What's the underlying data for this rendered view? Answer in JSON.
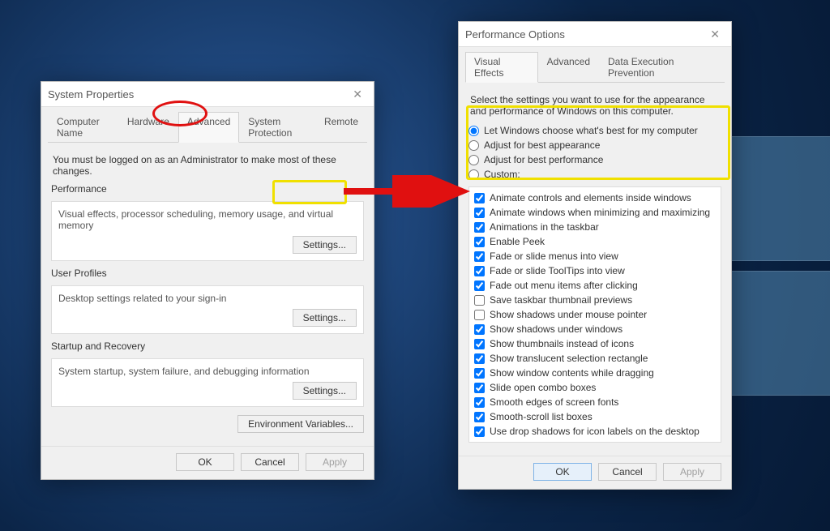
{
  "sys": {
    "title": "System Properties",
    "tabs": [
      "Computer Name",
      "Hardware",
      "Advanced",
      "System Protection",
      "Remote"
    ],
    "active_tab": 2,
    "admin_note": "You must be logged on as an Administrator to make most of these changes.",
    "perf": {
      "title": "Performance",
      "desc": "Visual effects, processor scheduling, memory usage, and virtual memory",
      "btn": "Settings..."
    },
    "profiles": {
      "title": "User Profiles",
      "desc": "Desktop settings related to your sign-in",
      "btn": "Settings..."
    },
    "startup": {
      "title": "Startup and Recovery",
      "desc": "System startup, system failure, and debugging information",
      "btn": "Settings..."
    },
    "envvar_btn": "Environment Variables...",
    "ok": "OK",
    "cancel": "Cancel",
    "apply": "Apply"
  },
  "perf": {
    "title": "Performance Options",
    "tabs": [
      "Visual Effects",
      "Advanced",
      "Data Execution Prevention"
    ],
    "active_tab": 0,
    "intro": "Select the settings you want to use for the appearance and performance of Windows on this computer.",
    "radios": [
      {
        "label": "Let Windows choose what's best for my computer",
        "checked": true
      },
      {
        "label": "Adjust for best appearance",
        "checked": false
      },
      {
        "label": "Adjust for best performance",
        "checked": false
      },
      {
        "label": "Custom:",
        "checked": false
      }
    ],
    "checks": [
      {
        "label": "Animate controls and elements inside windows",
        "checked": true
      },
      {
        "label": "Animate windows when minimizing and maximizing",
        "checked": true
      },
      {
        "label": "Animations in the taskbar",
        "checked": true
      },
      {
        "label": "Enable Peek",
        "checked": true
      },
      {
        "label": "Fade or slide menus into view",
        "checked": true
      },
      {
        "label": "Fade or slide ToolTips into view",
        "checked": true
      },
      {
        "label": "Fade out menu items after clicking",
        "checked": true
      },
      {
        "label": "Save taskbar thumbnail previews",
        "checked": false
      },
      {
        "label": "Show shadows under mouse pointer",
        "checked": false
      },
      {
        "label": "Show shadows under windows",
        "checked": true
      },
      {
        "label": "Show thumbnails instead of icons",
        "checked": true
      },
      {
        "label": "Show translucent selection rectangle",
        "checked": true
      },
      {
        "label": "Show window contents while dragging",
        "checked": true
      },
      {
        "label": "Slide open combo boxes",
        "checked": true
      },
      {
        "label": "Smooth edges of screen fonts",
        "checked": true
      },
      {
        "label": "Smooth-scroll list boxes",
        "checked": true
      },
      {
        "label": "Use drop shadows for icon labels on the desktop",
        "checked": true
      }
    ],
    "ok": "OK",
    "cancel": "Cancel",
    "apply": "Apply"
  }
}
